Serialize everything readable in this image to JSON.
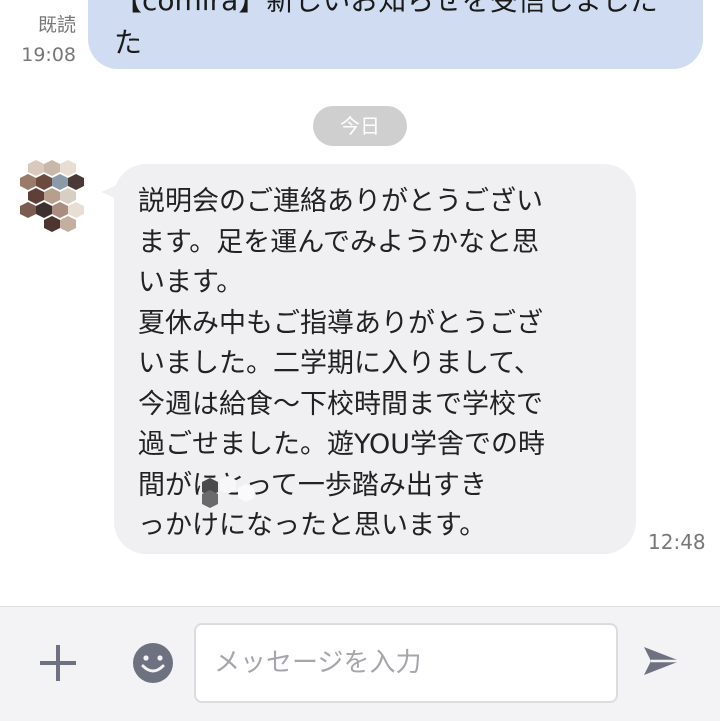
{
  "sent_message": {
    "read_label": "既読",
    "time": "19:08",
    "text_line1": "【comira】新しいお知らせを受信しました",
    "text_line2": "た"
  },
  "date_separator": "今日",
  "received_message": {
    "lines": [
      "説明会のご連絡ありがとうござい",
      "ます。足を運んでみようかなと思",
      "います。",
      "夏休み中もご指導ありがとうござ",
      "いました。二学期に入りまして、",
      "今週は給食〜下校時間まで学校で",
      "過ごせました。遊YOU学舎での時",
      "にとって一歩踏み出すき",
      "っかけになったと思います。"
    ],
    "line8_prefix": "間が",
    "time": "12:48"
  },
  "input_bar": {
    "placeholder": "メッセージを入力",
    "value": ""
  },
  "icons": {
    "add": "plus-icon",
    "emoji": "emoji-icon",
    "send": "send-icon"
  },
  "colors": {
    "sent_bubble": "#cfdcf2",
    "received_bubble": "#f0f0f2",
    "date_pill": "#cfcfcf",
    "icon": "#6e7280"
  }
}
